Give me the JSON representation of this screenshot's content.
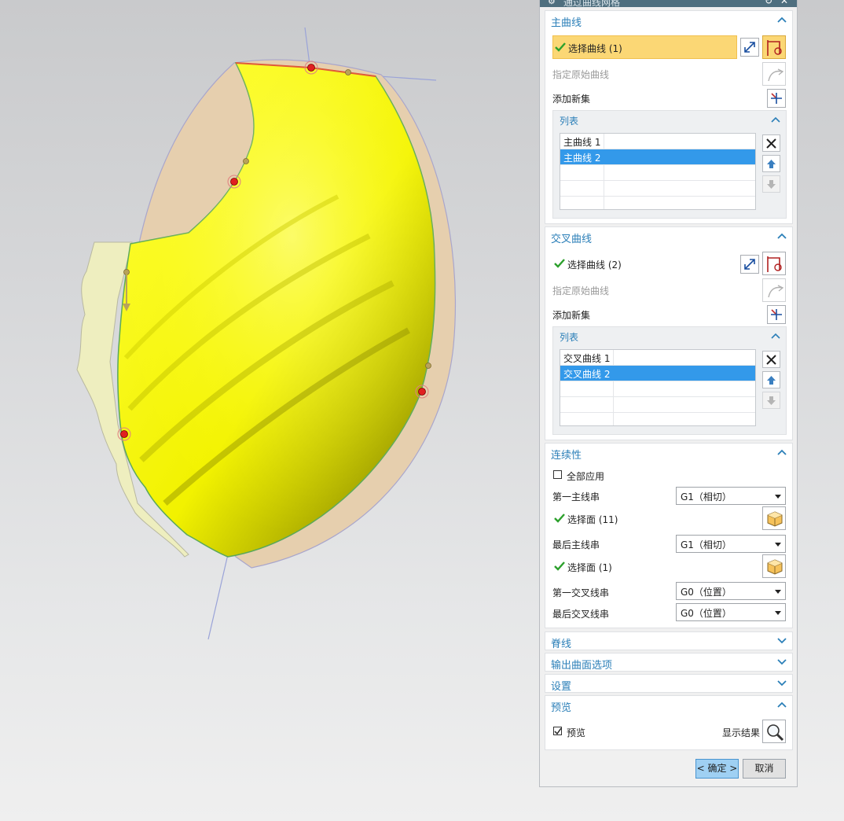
{
  "dialog": {
    "title": "通过曲线网格",
    "main_curves": {
      "title": "主曲线",
      "select_label": "选择曲线 (1)",
      "specify_origin": "指定原始曲线",
      "add_new_set": "添加新集",
      "list_title": "列表",
      "items": [
        "主曲线 1",
        "主曲线 2"
      ]
    },
    "cross_curves": {
      "title": "交叉曲线",
      "select_label": "选择曲线 (2)",
      "specify_origin": "指定原始曲线",
      "add_new_set": "添加新集",
      "list_title": "列表",
      "items": [
        "交叉曲线 1",
        "交叉曲线 2"
      ]
    },
    "continuity": {
      "title": "连续性",
      "apply_all": "全部应用",
      "first_primary_label": "第一主线串",
      "first_primary_value": "G1（相切）",
      "first_primary_faces": "选择面 (11)",
      "last_primary_label": "最后主线串",
      "last_primary_value": "G1（相切）",
      "last_primary_faces": "选择面 (1)",
      "first_cross_label": "第一交叉线串",
      "first_cross_value": "G0（位置）",
      "last_cross_label": "最后交叉线串",
      "last_cross_value": "G0（位置）"
    },
    "spine": {
      "title": "脊线"
    },
    "output_options": {
      "title": "输出曲面选项"
    },
    "settings": {
      "title": "设置"
    },
    "preview": {
      "title": "预览",
      "checkbox_label": "预览",
      "show_result_label": "显示结果"
    },
    "ok_label": "< 确定 >",
    "cancel_label": "取消"
  },
  "colors": {
    "surface": "#ffff00",
    "section_title": "#2b7fb8",
    "highlight": "#fbd775",
    "list_selection": "#3399ea",
    "check": "#2ca02c"
  }
}
